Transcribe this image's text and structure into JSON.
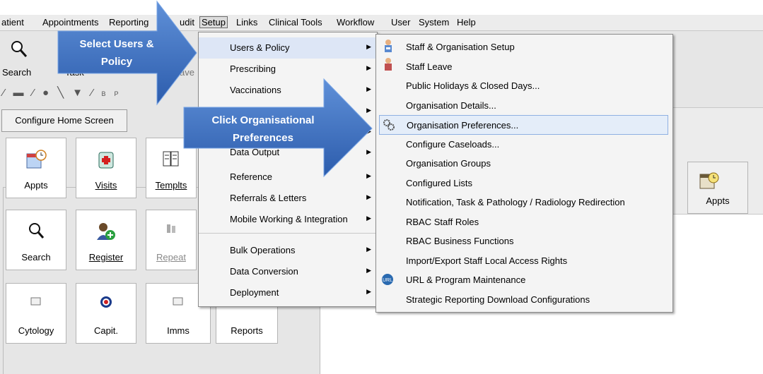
{
  "menubar": {
    "items": [
      "atient",
      "Appointments",
      "Reporting",
      "udit",
      "Setup",
      "Links",
      "Clinical Tools",
      "Workflow",
      "User",
      "System",
      "Help"
    ]
  },
  "toolbar": {
    "search_label": "Search",
    "task_label": "Task",
    "leave_label": "ave",
    "configure_label": "Configure Home Screen"
  },
  "tiles": [
    {
      "label": "Appts",
      "icon": "calendar-clock-icon"
    },
    {
      "label": "Visits",
      "icon": "first-aid-icon"
    },
    {
      "label": "Templts",
      "icon": "book-icon"
    },
    {
      "label": "Search",
      "icon": "magnifier-icon"
    },
    {
      "label": "Register",
      "icon": "add-person-icon"
    },
    {
      "label": "Repeat",
      "icon": "pills-icon"
    },
    {
      "label": "Cytology",
      "icon": "folder-icon"
    },
    {
      "label": "Capit.",
      "icon": "target-icon"
    },
    {
      "label": "Imms",
      "icon": "folder-icon"
    },
    {
      "label": "Reports",
      "icon": "report-icon"
    }
  ],
  "right_panel": {
    "appts_label": "Appts"
  },
  "setup_menu": {
    "items": [
      {
        "label": "Users & Policy",
        "submenu": true
      },
      {
        "label": "Prescribing",
        "submenu": true
      },
      {
        "label": "Vaccinations",
        "submenu": true
      },
      {
        "label": "",
        "submenu": true
      },
      {
        "label": "",
        "submenu": true
      },
      {
        "label": "Data Output",
        "submenu": true
      },
      {
        "label": "Reference",
        "submenu": true
      },
      {
        "label": "Referrals & Letters",
        "submenu": true
      },
      {
        "label": "Mobile Working & Integration",
        "submenu": true
      },
      {
        "label": "Bulk Operations",
        "submenu": true
      },
      {
        "label": "Data Conversion",
        "submenu": true
      },
      {
        "label": "Deployment",
        "submenu": true
      }
    ]
  },
  "submenu": {
    "items": [
      {
        "label": "Staff & Organisation Setup",
        "icon": "staff-icon"
      },
      {
        "label": "Staff Leave",
        "icon": "staff-leave-icon"
      },
      {
        "label": "Public Holidays & Closed Days...",
        "icon": ""
      },
      {
        "label": "Organisation Details...",
        "icon": ""
      },
      {
        "label": "Organisation Preferences...",
        "icon": "gears-icon"
      },
      {
        "label": "Configure Caseloads...",
        "icon": ""
      },
      {
        "label": "Organisation Groups",
        "icon": ""
      },
      {
        "label": "Configured Lists",
        "icon": ""
      },
      {
        "label": "Notification, Task & Pathology / Radiology Redirection",
        "icon": ""
      },
      {
        "label": "RBAC Staff Roles",
        "icon": ""
      },
      {
        "label": "RBAC Business Functions",
        "icon": ""
      },
      {
        "label": "Import/Export Staff Local Access Rights",
        "icon": ""
      },
      {
        "label": "URL & Program Maintenance",
        "icon": "url-icon"
      },
      {
        "label": "Strategic Reporting Download Configurations",
        "icon": ""
      }
    ]
  },
  "callouts": {
    "select_users": "Select Users & Policy",
    "click_org": "Click Organisational Preferences"
  },
  "colors": {
    "accent": "#3a6cc0",
    "highlight": "#dde6f6"
  }
}
